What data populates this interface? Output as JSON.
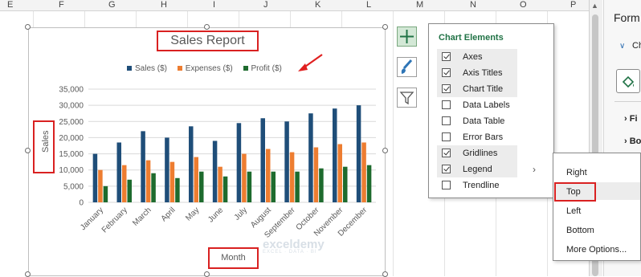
{
  "sheet": {
    "columns": [
      "E",
      "F",
      "G",
      "H",
      "I",
      "J",
      "K",
      "L",
      "M",
      "N",
      "O",
      "P"
    ]
  },
  "chart": {
    "title": "Sales Report",
    "x_axis_title": "Month",
    "y_axis_title": "Sales"
  },
  "chart_data": {
    "type": "bar",
    "title": "Sales Report",
    "xlabel": "Month",
    "ylabel": "Sales",
    "ylim": [
      0,
      35000
    ],
    "y_ticks": [
      "0",
      "5,000",
      "10,000",
      "15,000",
      "20,000",
      "25,000",
      "30,000",
      "35,000"
    ],
    "categories": [
      "January",
      "February",
      "March",
      "April",
      "May",
      "June",
      "July",
      "August",
      "September",
      "October",
      "November",
      "December"
    ],
    "series": [
      {
        "name": "Sales ($)",
        "color": "#1f4e79",
        "values": [
          15000,
          18500,
          22000,
          20000,
          23500,
          19000,
          24500,
          26000,
          25000,
          27500,
          29000,
          30000
        ]
      },
      {
        "name": "Expenses ($)",
        "color": "#ed7d31",
        "values": [
          10000,
          11500,
          13000,
          12500,
          14000,
          11000,
          15000,
          16500,
          15500,
          17000,
          18000,
          18500
        ]
      },
      {
        "name": "Profit ($)",
        "color": "#1e6b2e",
        "values": [
          5000,
          7000,
          9000,
          7500,
          9500,
          8000,
          9500,
          9500,
          9500,
          10500,
          11000,
          11500
        ]
      }
    ],
    "grid": true,
    "legend_position": "top"
  },
  "chart_elements": {
    "title": "Chart Elements",
    "items": [
      {
        "label": "Axes",
        "checked": true
      },
      {
        "label": "Axis Titles",
        "checked": true
      },
      {
        "label": "Chart Title",
        "checked": true
      },
      {
        "label": "Data Labels",
        "checked": false
      },
      {
        "label": "Data Table",
        "checked": false
      },
      {
        "label": "Error Bars",
        "checked": false
      },
      {
        "label": "Gridlines",
        "checked": true
      },
      {
        "label": "Legend",
        "checked": true
      },
      {
        "label": "Trendline",
        "checked": false
      }
    ],
    "legend_arrow": "›"
  },
  "legend_submenu": {
    "options": [
      "Right",
      "Top",
      "Left",
      "Bottom",
      "More Options..."
    ],
    "selected": "Top"
  },
  "side_buttons": [
    "plus-icon",
    "brush-icon",
    "filter-icon"
  ],
  "format_pane": {
    "title": "Form",
    "tab": "Ch",
    "rows": [
      "Fi",
      "Bo"
    ]
  },
  "watermark": {
    "name": "exceldemy",
    "tagline": "EXCEL · DATA · BI"
  }
}
